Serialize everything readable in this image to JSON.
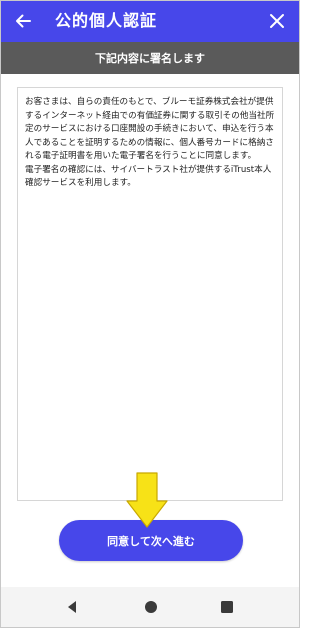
{
  "header": {
    "title": "公的個人認証",
    "accent_color": "#4747ea",
    "back_icon": "arrow-left-icon",
    "close_icon": "close-icon"
  },
  "subheader": {
    "text": "下記内容に署名します"
  },
  "content": {
    "paragraph1": "お客さまは、自らの責任のもとで、ブルーモ証券株式会社が提供するインターネット経由での有価証券に関する取引その他当社所定のサービスにおける口座開設の手続きにおいて、申込を行う本人であることを証明するための情報に、個人番号カードに格納される電子証明書を用いた電子署名を行うことに同意します。",
    "paragraph2": "電子署名の確認には、サイバートラスト社が提供するiTrust本人確認サービスを利用します。"
  },
  "annotation": {
    "arrow_icon": "down-arrow-icon",
    "arrow_color": "#f7e217"
  },
  "footer": {
    "agree_button_label": "同意して次へ進む"
  },
  "navbar": {
    "back_icon": "nav-back-icon",
    "home_icon": "nav-home-icon",
    "recent_icon": "nav-recent-icon"
  }
}
